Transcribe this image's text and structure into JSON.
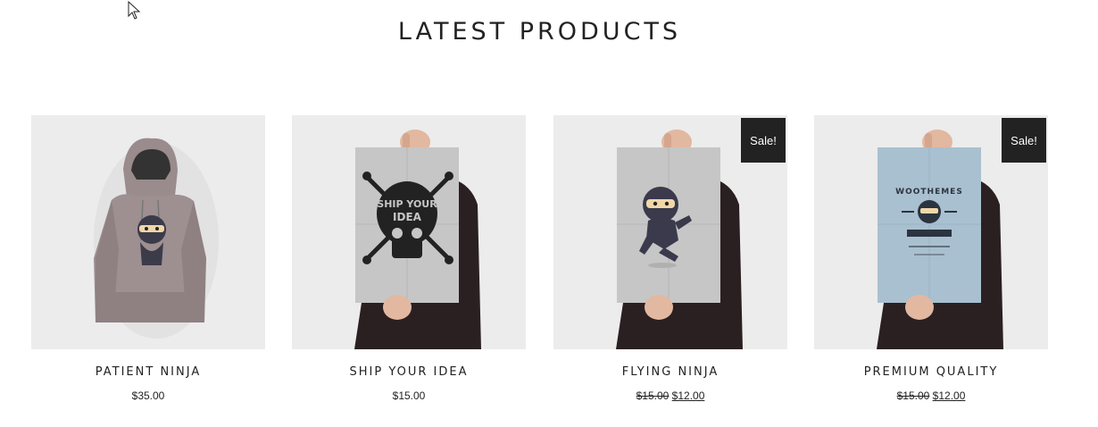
{
  "section": {
    "title": "LATEST PRODUCTS"
  },
  "colors": {
    "badge_bg": "#222222",
    "thumb_bg": "#ececec",
    "text": "#222222"
  },
  "products": [
    {
      "name": "PATIENT NINJA",
      "price": "$35.00",
      "image_icon": "hoodie-ninja-image"
    },
    {
      "name": "SHIP YOUR IDEA",
      "price": "$15.00",
      "image_icon": "poster-skull-image",
      "poster_text": "SHIP YOUR IDEA"
    },
    {
      "name": "FLYING NINJA",
      "old_price": "$15.00",
      "price": "$12.00",
      "badge": "Sale!",
      "image_icon": "poster-ninja-image"
    },
    {
      "name": "PREMIUM QUALITY",
      "old_price": "$15.00",
      "price": "$12.00",
      "badge": "Sale!",
      "image_icon": "poster-woothemes-image",
      "poster_text": "WOOTHEMES"
    }
  ]
}
